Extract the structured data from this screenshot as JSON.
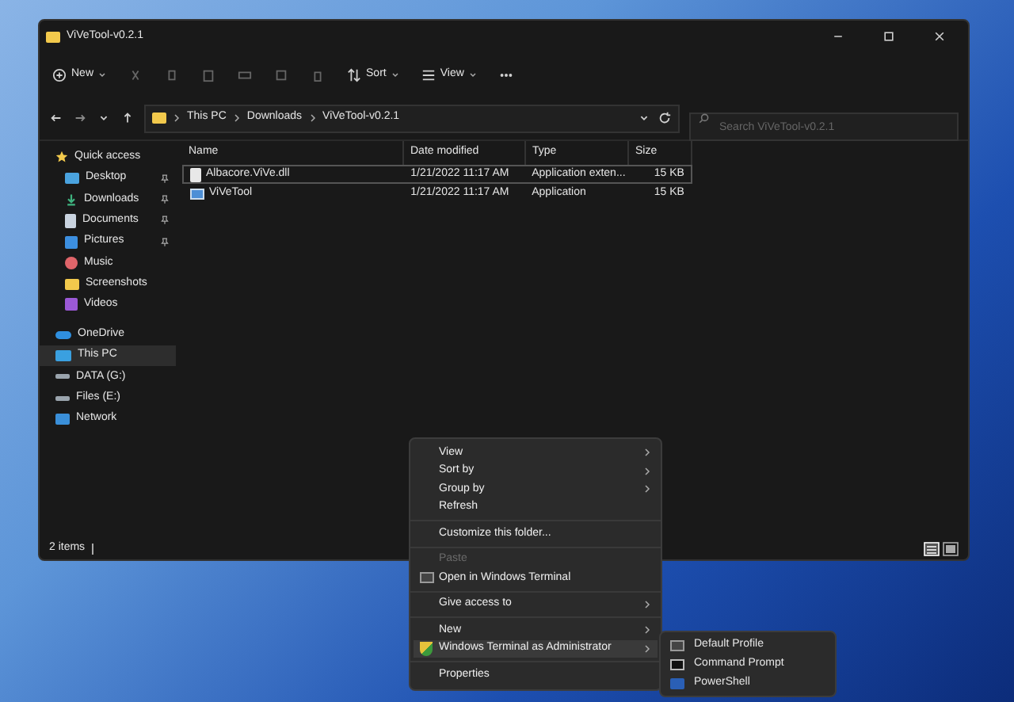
{
  "window": {
    "title": "ViVeTool-v0.2.1"
  },
  "toolbar": {
    "new_label": "New",
    "sort_label": "Sort",
    "view_label": "View"
  },
  "address": {
    "breadcrumbs": [
      "This PC",
      "Downloads",
      "ViVeTool-v0.2.1"
    ],
    "search": {
      "placeholder": "Search ViVeTool-v0.2.1"
    }
  },
  "sidebar": {
    "items": [
      {
        "label": "Quick access",
        "kind": "star",
        "selected": false,
        "children": [
          {
            "label": "Desktop",
            "kind": "desktop",
            "pinned": true,
            "selected": false
          },
          {
            "label": "Downloads",
            "kind": "download",
            "pinned": true,
            "selected": false
          },
          {
            "label": "Documents",
            "kind": "document",
            "pinned": true,
            "selected": false
          },
          {
            "label": "Pictures",
            "kind": "pictures",
            "pinned": true,
            "selected": false
          },
          {
            "label": "Music",
            "kind": "music",
            "pinned": false,
            "selected": false
          },
          {
            "label": "Screenshots",
            "kind": "folder",
            "pinned": false,
            "selected": false
          },
          {
            "label": "Videos",
            "kind": "videos",
            "pinned": false,
            "selected": false
          }
        ]
      },
      {
        "label": "OneDrive",
        "kind": "cloud",
        "selected": false
      },
      {
        "label": "This PC",
        "kind": "pc",
        "selected": true
      },
      {
        "label": "DATA (G:)",
        "kind": "drive",
        "selected": false
      },
      {
        "label": "Files (E:)",
        "kind": "drive",
        "selected": false
      },
      {
        "label": "Network",
        "kind": "network",
        "selected": false
      }
    ]
  },
  "table": {
    "columns": [
      "Name",
      "Date modified",
      "Type",
      "Size"
    ],
    "rows": [
      {
        "kind": "dll",
        "focused": true,
        "cells": [
          "Albacore.ViVe.dll",
          "1/21/2022 11:17 AM",
          "Application exten...",
          "15 KB"
        ]
      },
      {
        "kind": "app",
        "focused": false,
        "cells": [
          "ViVeTool",
          "1/21/2022 11:17 AM",
          "Application",
          "15 KB"
        ]
      }
    ]
  },
  "status_bar": {
    "text": "2 items",
    "views": [
      {
        "kind": "details",
        "selected": true
      },
      {
        "kind": "tiles",
        "selected": false
      }
    ]
  },
  "context_menu": {
    "items": [
      {
        "kind": "item",
        "label": "View",
        "submenu": true,
        "disabled": false,
        "highlighted": false
      },
      {
        "kind": "item",
        "label": "Sort by",
        "submenu": true,
        "disabled": false,
        "highlighted": false
      },
      {
        "kind": "item",
        "label": "Group by",
        "submenu": true,
        "disabled": false,
        "highlighted": false
      },
      {
        "kind": "item",
        "label": "Refresh",
        "submenu": false,
        "disabled": false,
        "highlighted": false
      },
      {
        "kind": "separator"
      },
      {
        "kind": "item",
        "label": "Customize this folder...",
        "submenu": false,
        "disabled": false,
        "highlighted": false
      },
      {
        "kind": "separator"
      },
      {
        "kind": "item",
        "label": "Paste",
        "submenu": false,
        "disabled": true,
        "highlighted": false
      },
      {
        "kind": "terminal",
        "label": "Open in Windows Terminal",
        "submenu": false,
        "disabled": false,
        "highlighted": false
      },
      {
        "kind": "separator"
      },
      {
        "kind": "item",
        "label": "Give access to",
        "submenu": true,
        "disabled": false,
        "highlighted": false
      },
      {
        "kind": "separator"
      },
      {
        "kind": "item",
        "label": "New",
        "submenu": true,
        "disabled": false,
        "highlighted": false
      },
      {
        "kind": "shield",
        "label": "Windows Terminal as Administrator",
        "submenu": true,
        "disabled": false,
        "highlighted": true
      },
      {
        "kind": "separator"
      },
      {
        "kind": "item",
        "label": "Properties",
        "submenu": false,
        "disabled": false,
        "highlighted": false
      }
    ]
  },
  "submenu": {
    "items": [
      {
        "label": "Default Profile",
        "kind": "terminal",
        "highlighted": false
      },
      {
        "label": "Command Prompt",
        "kind": "cmd",
        "highlighted": false
      },
      {
        "label": "PowerShell",
        "kind": "powershell",
        "highlighted": false
      }
    ]
  }
}
